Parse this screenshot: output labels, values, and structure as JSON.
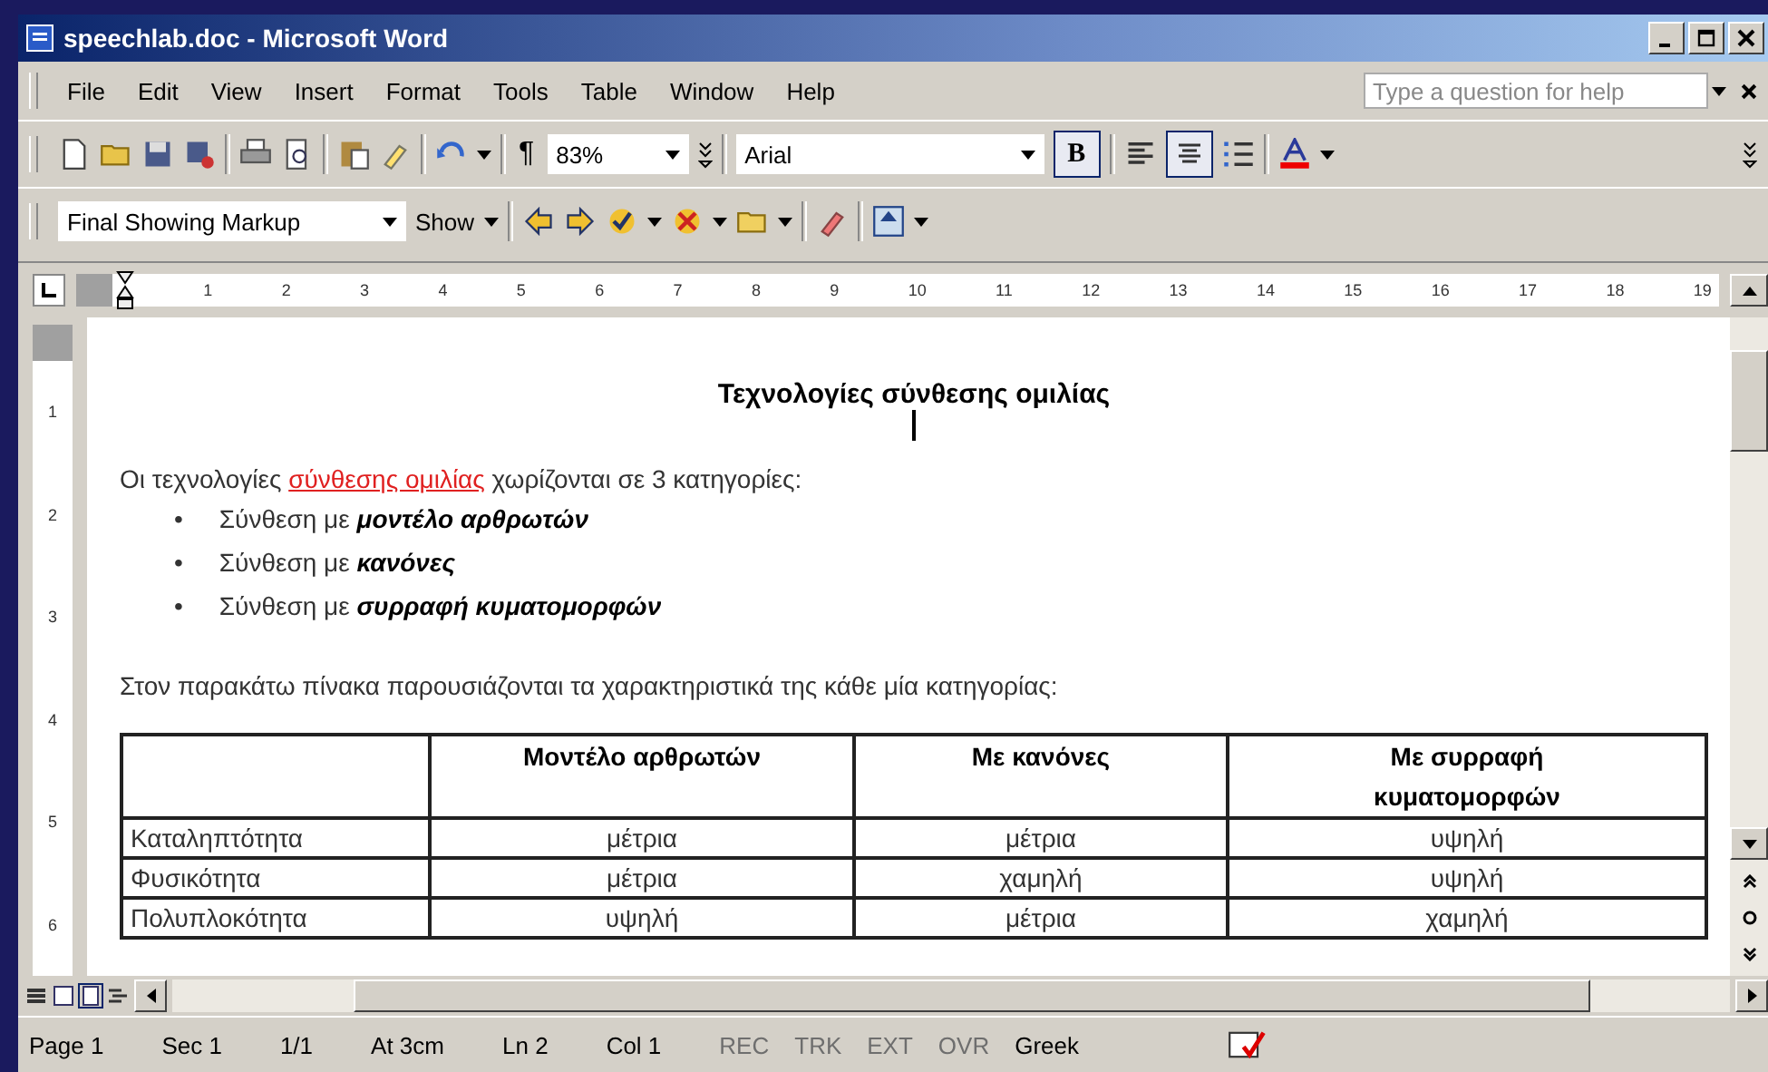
{
  "window": {
    "title": "speechlab.doc - Microsoft Word"
  },
  "menu": [
    {
      "label": "File"
    },
    {
      "label": "Edit"
    },
    {
      "label": "View"
    },
    {
      "label": "Insert"
    },
    {
      "label": "Format"
    },
    {
      "label": "Tools"
    },
    {
      "label": "Table"
    },
    {
      "label": "Window"
    },
    {
      "label": "Help"
    }
  ],
  "help_search": {
    "placeholder": "Type a question for help"
  },
  "formatting": {
    "pilcrow": "¶",
    "zoom": "83%",
    "font": "Arial",
    "bold": {
      "label": "B",
      "selected": true
    },
    "align_center": {
      "selected": true
    }
  },
  "reviewing": {
    "display": "Final Showing Markup",
    "show": "Show"
  },
  "ruler": {
    "numbers": [
      "1",
      "2",
      "3",
      "4",
      "5",
      "6",
      "7",
      "8",
      "9",
      "10",
      "11",
      "12",
      "13",
      "14",
      "15",
      "16",
      "17",
      "18",
      "19"
    ],
    "vertical_numbers": [
      "1",
      "2",
      "3",
      "4",
      "5",
      "6"
    ]
  },
  "document": {
    "title": "Τεχνολογίες σύνθεσης ομιλίας",
    "intro": {
      "before": "Οι τεχνολογίες ",
      "marked": "σύνθεσης ομιλίας",
      "after": " χωρίζονται σε 3 κατηγορίες:"
    },
    "bullets": [
      {
        "marker": "•",
        "text": "Σύνθεση με ",
        "emphasis": "μοντέλο αρθρωτών"
      },
      {
        "marker": "•",
        "text": "Σύνθεση με ",
        "emphasis": "κανόνες"
      },
      {
        "marker": "•",
        "text": "Σύνθεση με ",
        "emphasis": "συρραφή κυματομορφών"
      }
    ],
    "table_intro": "Στον παρακάτω πίνακα παρουσιάζονται τα χαρακτηριστικά της κάθε μία κατηγορίας:",
    "table": {
      "columns": [
        "",
        "Μοντέλο αρθρωτών",
        "Με κανόνες",
        "Με συρραφή κυματομορφών"
      ],
      "rows": [
        [
          "Καταληπτότητα",
          "μέτρια",
          "μέτρια",
          "υψηλή"
        ],
        [
          "Φυσικότητα",
          "μέτρια",
          "χαμηλή",
          "υψηλή"
        ],
        [
          "Πολυπλοκότητα",
          "υψηλή",
          "μέτρια",
          "χαμηλή"
        ]
      ]
    }
  },
  "status_bar": [
    {
      "text": "Page 1",
      "disabled": false
    },
    {
      "text": "Sec 1",
      "disabled": false
    },
    {
      "text": "1/1",
      "disabled": false
    },
    {
      "text": "At 3cm",
      "disabled": false
    },
    {
      "text": "Ln 2",
      "disabled": false
    },
    {
      "text": "Col 1",
      "disabled": false
    },
    {
      "text": "REC",
      "disabled": true
    },
    {
      "text": "TRK",
      "disabled": true
    },
    {
      "text": "EXT",
      "disabled": true
    },
    {
      "text": "OVR",
      "disabled": true
    },
    {
      "text": "Greek",
      "disabled": false
    }
  ]
}
